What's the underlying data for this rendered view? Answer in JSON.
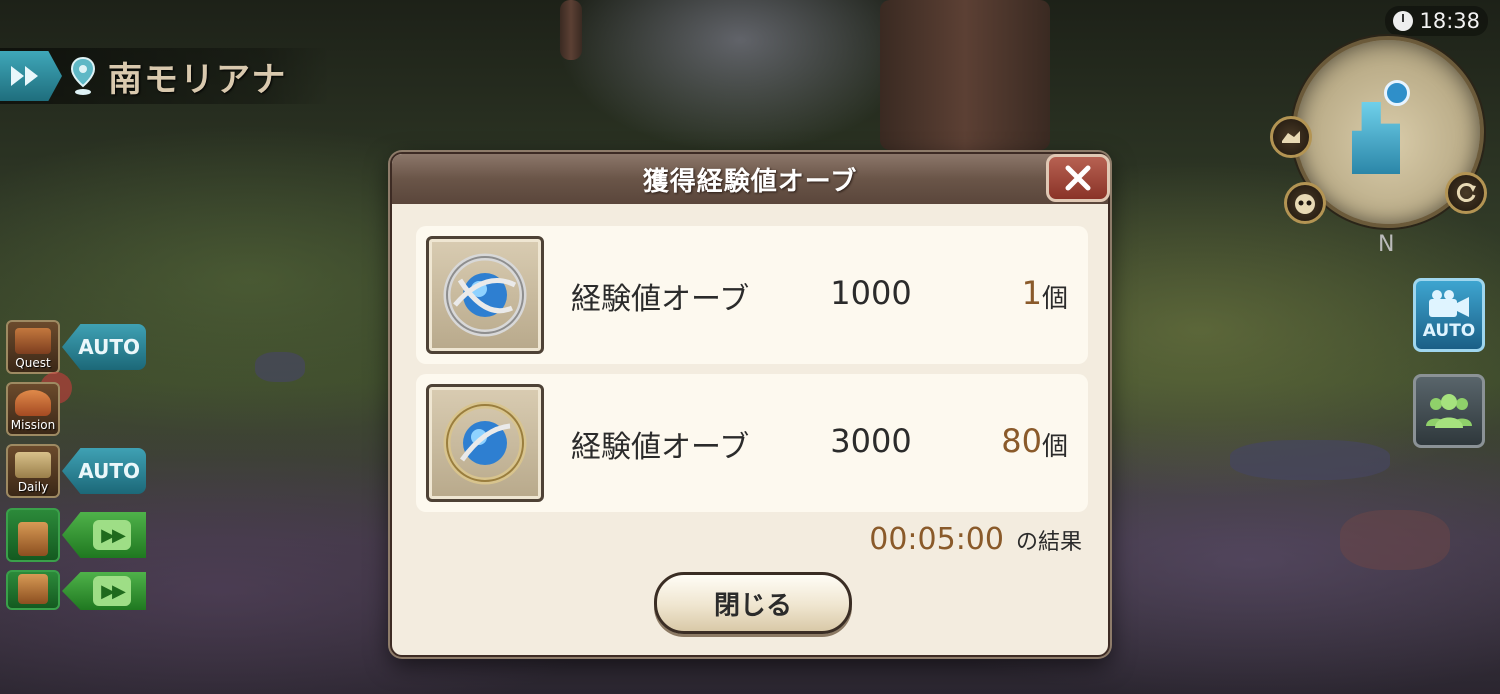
{
  "location": {
    "name": "南モリアナ"
  },
  "clock": {
    "time": "18:38"
  },
  "minimap": {
    "compass": "N"
  },
  "right_buttons": {
    "auto_camera_label": "AUTO"
  },
  "left_menu": {
    "quest_label": "Quest",
    "mission_label": "Mission",
    "daily_label": "Daily",
    "auto_label": "AUTO"
  },
  "dialog": {
    "title": "獲得経験値オーブ",
    "items": [
      {
        "name": "経験値オーブ",
        "value": "1000",
        "count": "1",
        "unit": "個",
        "icon": "experience-orb-icon"
      },
      {
        "name": "経験値オーブ",
        "value": "3000",
        "count": "80",
        "unit": "個",
        "icon": "experience-orb-icon"
      }
    ],
    "result_time": "00:05:00",
    "result_suffix": "の結果",
    "close_button_label": "閉じる"
  },
  "colors": {
    "dialog_bg": "#f3ecdf",
    "header_brown": "#6a5548",
    "count_brown": "#8a5a2a",
    "close_red": "#8a3328",
    "auto_teal": "#1c6878",
    "skip_green": "#1f7820"
  }
}
